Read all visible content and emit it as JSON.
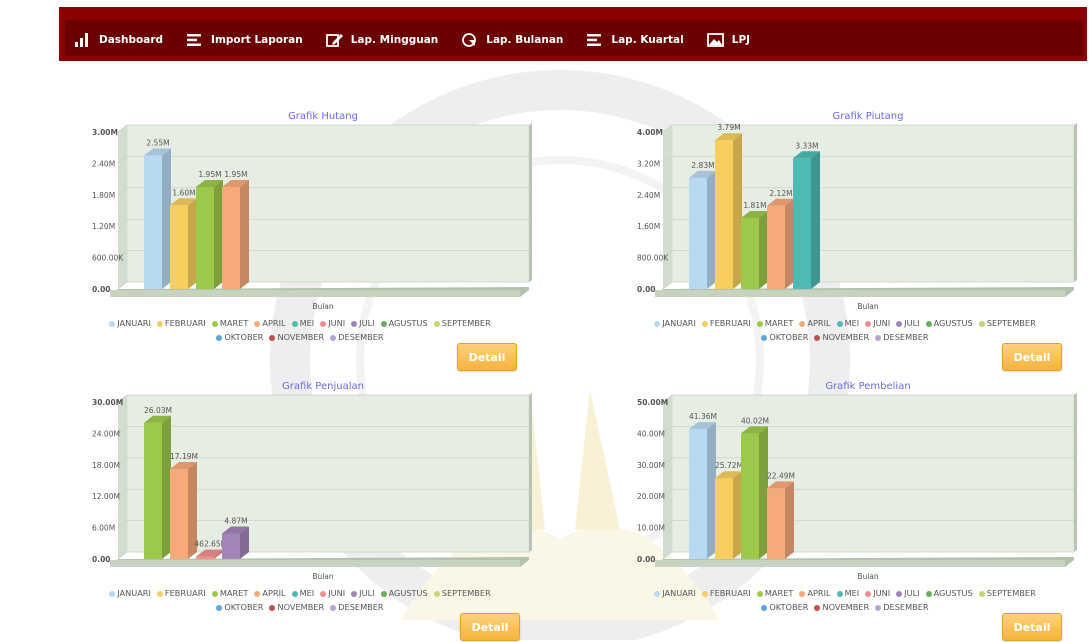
{
  "nav": {
    "items": [
      {
        "label": "Dashboard",
        "icon": "bar-chart-icon"
      },
      {
        "label": "Import Laporan",
        "icon": "list-icon"
      },
      {
        "label": "Lap. Mingguan",
        "icon": "edit-icon"
      },
      {
        "label": "Lap. Bulanan",
        "icon": "pie-chart-icon"
      },
      {
        "label": "Lap. Kuartal",
        "icon": "list-icon"
      },
      {
        "label": "LPJ",
        "icon": "image-icon"
      }
    ]
  },
  "detail_label": "Detail",
  "legend": {
    "months": [
      "JANUARI",
      "FEBRUARI",
      "MARET",
      "APRIL",
      "MEI",
      "JUNI",
      "JULI",
      "AGUSTUS",
      "SEPTEMBER",
      "OKTOBER",
      "NOVEMBER",
      "DESEMBER"
    ],
    "colors": [
      "#b8d9f2",
      "#f7cf5e",
      "#9cc84b",
      "#f6a979",
      "#4fbab4",
      "#f28e8e",
      "#a184b8",
      "#6aab5c",
      "#c3d869",
      "#5aa8de",
      "#c24d4d",
      "#b6a4d4"
    ]
  },
  "colors": {
    "nav_bg": "#8b0000",
    "title": "#6a6ae8",
    "plot_bg": "#dfe8dd"
  },
  "chart_data": [
    {
      "type": "bar",
      "title": "Grafik Hutang",
      "xlabel": "Bulan",
      "ylabel": "",
      "ylim": [
        0,
        3000000
      ],
      "yticks": [
        "0.00",
        "600.00K",
        "1.20M",
        "1.80M",
        "2.40M",
        "3.00M"
      ],
      "categories": [
        "JANUARI",
        "FEBRUARI",
        "MARET",
        "APRIL"
      ],
      "values": [
        2550000,
        1600000,
        1950000,
        1950000
      ],
      "labels": [
        "2.55M",
        "1.60M",
        "1.95M",
        "1.95M"
      ]
    },
    {
      "type": "bar",
      "title": "Grafik Piutang",
      "xlabel": "Bulan",
      "ylabel": "",
      "ylim": [
        0,
        4000000
      ],
      "yticks": [
        "0.00",
        "800.00K",
        "1.60M",
        "2.40M",
        "3.20M",
        "4.00M"
      ],
      "categories": [
        "JANUARI",
        "FEBRUARI",
        "MARET",
        "APRIL",
        "MEI"
      ],
      "values": [
        2830000,
        3790000,
        1810000,
        2120000,
        3330000
      ],
      "labels": [
        "2.83M",
        "3.79M",
        "1.81M",
        "2.12M",
        "3.33M"
      ]
    },
    {
      "type": "bar",
      "title": "Grafik Penjualan",
      "xlabel": "Bulan",
      "ylabel": "",
      "ylim": [
        0,
        30000000
      ],
      "yticks": [
        "0.00",
        "6.00M",
        "12.00M",
        "18.00M",
        "24.00M",
        "30.00M"
      ],
      "categories": [
        "MARET",
        "APRIL",
        "JUNI",
        "JULI"
      ],
      "values": [
        26030000,
        17190000,
        462650,
        4870000
      ],
      "labels": [
        "26.03M",
        "17.19M",
        "462.65K",
        "4.87M"
      ]
    },
    {
      "type": "bar",
      "title": "Grafik Pembelian",
      "xlabel": "Bulan",
      "ylabel": "",
      "ylim": [
        0,
        50000000
      ],
      "yticks": [
        "0.00",
        "10.00M",
        "20.00M",
        "30.00M",
        "40.00M",
        "50.00M"
      ],
      "categories": [
        "JANUARI",
        "FEBRUARI",
        "MARET",
        "APRIL"
      ],
      "values": [
        41360000,
        25720000,
        40020000,
        22490000
      ],
      "labels": [
        "41.36M",
        "25.72M",
        "40.02M",
        "22.49M"
      ]
    }
  ]
}
